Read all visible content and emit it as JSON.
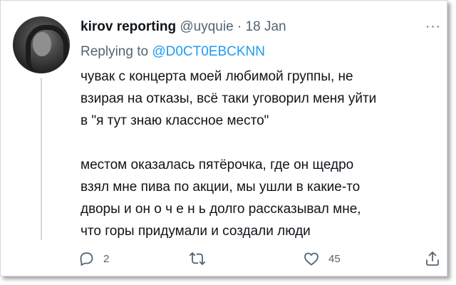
{
  "tweet": {
    "display_name": "kirov reporting",
    "handle": "@uyquie",
    "separator": "·",
    "date": "18 Jan",
    "more_label": "···",
    "replying_to_label": "Replying to",
    "replying_to_handle": "@D0CT0EBCKNN",
    "text_paragraph_1": [
      "чувак с концерта моей любимой группы, не",
      "взирая на отказы, всё таки уговорил меня уйти",
      "в \"я тут знаю классное место\""
    ],
    "text_paragraph_2": [
      "местом оказалась пятёрочка, где он щедро",
      "взял мне пива по акции, мы ушли в какие-то",
      "дворы и он о ч е н ь долго рассказывал мне,",
      "что горы придумали и создали люди"
    ]
  },
  "actions": {
    "reply_icon": "speech-bubble-icon",
    "reply_count": "2",
    "retweet_icon": "retweet-arrows-icon",
    "retweet_count": "",
    "like_icon": "heart-icon",
    "like_count": "45",
    "share_icon": "share-upload-icon"
  },
  "colors": {
    "text": "#0f1419",
    "muted": "#536471",
    "link": "#1d9bf0",
    "border": "#cfd9de"
  }
}
